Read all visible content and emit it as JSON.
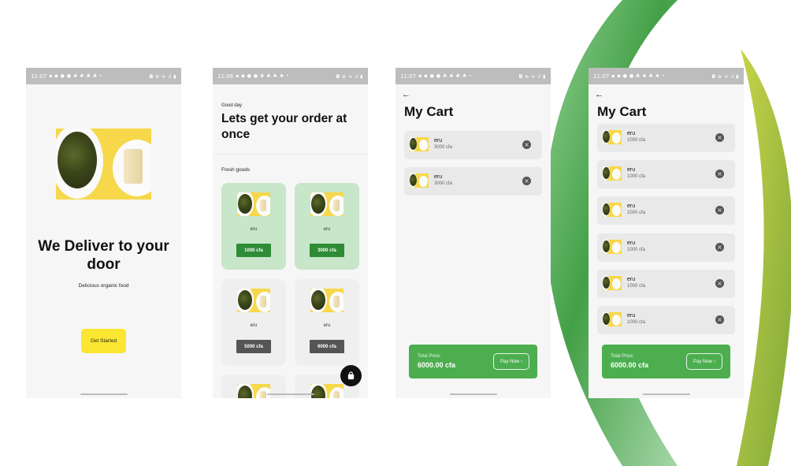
{
  "status_bars": [
    {
      "time": "11:07",
      "left_icons": "▪ ◆ ● ● ♣ ♣ ♣ ♣ •",
      "right_icons": "◘ ⊛ ᯤ ıl ▮"
    },
    {
      "time": "11:06",
      "left_icons": "▪ ◆ ● ● ♣ ♣ ♣ ♣ •",
      "right_icons": "◘ ⊛ ᯤ ıl ▮"
    },
    {
      "time": "11:07",
      "left_icons": "▪ ◆ ● ● ♣ ♣ ♣ ♣ •",
      "right_icons": "◘ ⊛ ᯤ ıl ▮"
    },
    {
      "time": "11:07",
      "left_icons": "▪ ◆ ● ● ♣ ♣ ♣ ♣ •",
      "right_icons": "◘ ⊛ ᯤ ıl ▮"
    }
  ],
  "welcome": {
    "headline": "We Deliver to your door",
    "subtitle": "Delicious organic food",
    "button": "Get Started"
  },
  "home": {
    "greeting": "Good day",
    "title": "Lets get your order at once",
    "section": "Fresh goods",
    "products": [
      {
        "name": "eru",
        "price": "1000 cfa",
        "selected": true
      },
      {
        "name": "eru",
        "price": "3000 cfa",
        "selected": true
      },
      {
        "name": "eru",
        "price": "5000 cfa",
        "selected": false
      },
      {
        "name": "eru",
        "price": "6000 cfa",
        "selected": false
      }
    ],
    "fab_icon": "shopping-bag-icon"
  },
  "cart_short": {
    "back_icon": "arrow-left-icon",
    "title": "My Cart",
    "items": [
      {
        "name": "eru",
        "price": "3000 cfa"
      },
      {
        "name": "eru",
        "price": "3000 cfa"
      }
    ],
    "total_label": "Total Price:",
    "total_value": "6000.00 cfa",
    "pay_label": "Pay Now",
    "remove_icon": "cancel-icon"
  },
  "cart_long": {
    "back_icon": "arrow-left-icon",
    "title": "My Cart",
    "items": [
      {
        "name": "eru",
        "price": "1000 cfa"
      },
      {
        "name": "eru",
        "price": "1000 cfa"
      },
      {
        "name": "eru",
        "price": "1000 cfa"
      },
      {
        "name": "eru",
        "price": "1000 cfa"
      },
      {
        "name": "eru",
        "price": "1000 cfa"
      },
      {
        "name": "eru",
        "price": "1000 cfa"
      }
    ],
    "total_label": "Total Price:",
    "total_value": "6000.00 cfa",
    "pay_label": "Pay Now"
  },
  "colors": {
    "accent_green": "#4cae4f",
    "selected_card": "#c8e6c9",
    "price_green": "#2e8b36",
    "cta_yellow": "#fbe631",
    "food_background": "#f7d84a"
  }
}
